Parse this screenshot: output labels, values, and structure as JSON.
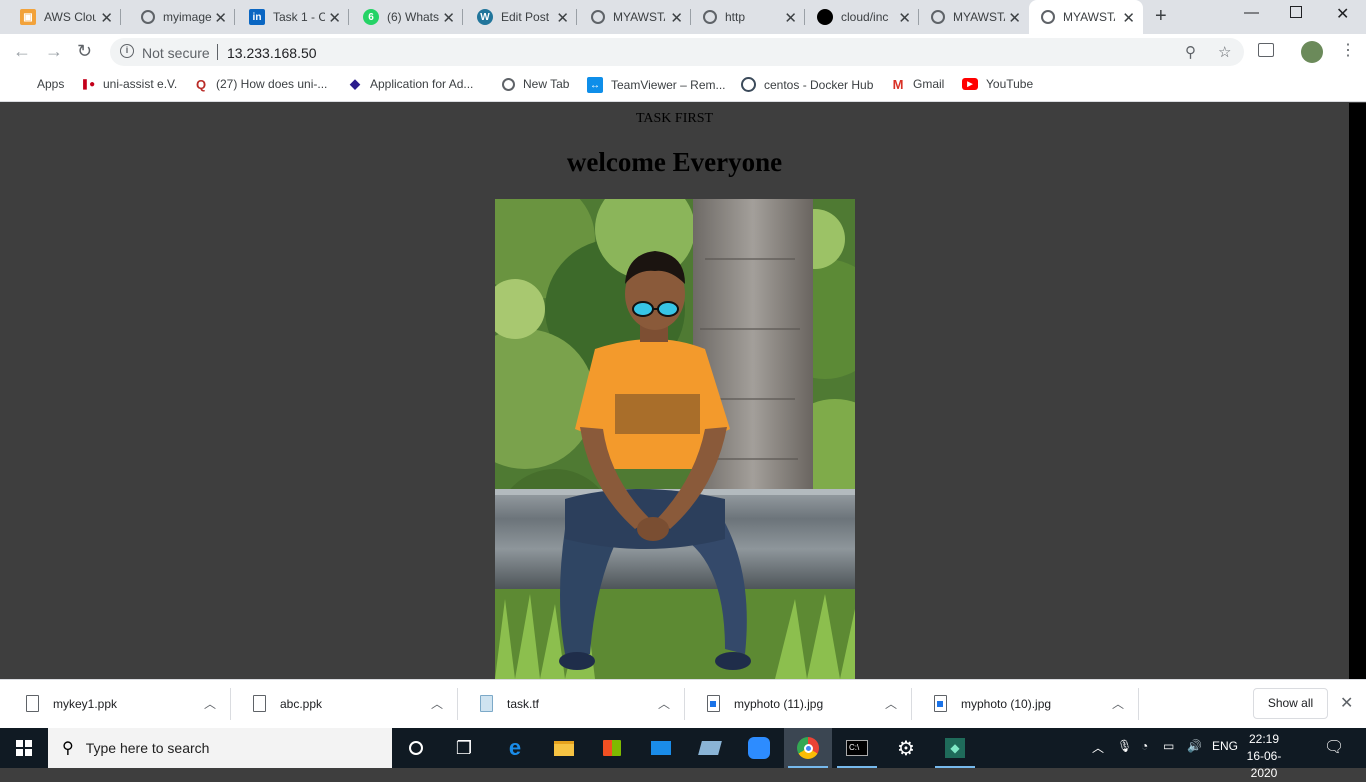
{
  "tabs": [
    {
      "title": "AWS Clou",
      "icon": "aws-box-icon",
      "color": "#f2a23a"
    },
    {
      "title": "myimage",
      "icon": "globe-icon",
      "color": "#5f6368"
    },
    {
      "title": "Task 1 - C",
      "icon": "linkedin-icon",
      "color": "#0a66c2"
    },
    {
      "title": "(6) Whats",
      "icon": "whatsapp-icon",
      "color": "#25d366"
    },
    {
      "title": "Edit Post",
      "icon": "wordpress-icon",
      "color": "#21759b"
    },
    {
      "title": "MYAWSTA",
      "icon": "globe-icon",
      "color": "#5f6368"
    },
    {
      "title": "http",
      "icon": "globe-icon",
      "color": "#5f6368"
    },
    {
      "title": "cloud/inc",
      "icon": "github-icon",
      "color": "#000000"
    },
    {
      "title": "MYAWSTA",
      "icon": "globe-icon",
      "color": "#5f6368"
    },
    {
      "title": "MYAWSTA",
      "icon": "globe-icon",
      "color": "#5f6368"
    }
  ],
  "address_bar": {
    "security_label": "Not secure",
    "url": "13.233.168.50"
  },
  "bookmarks": [
    {
      "label": "Apps",
      "icon": "apps-grid-icon"
    },
    {
      "label": "uni-assist e.V.",
      "icon": "uni-assist-icon"
    },
    {
      "label": "(27) How does uni-...",
      "icon": "quora-icon"
    },
    {
      "label": "Application for Ad...",
      "icon": "diamond-icon"
    },
    {
      "label": "New Tab",
      "icon": "globe-icon"
    },
    {
      "label": "TeamViewer – Rem...",
      "icon": "teamviewer-icon"
    },
    {
      "label": "centos - Docker Hub",
      "icon": "docker-icon"
    },
    {
      "label": "Gmail",
      "icon": "gmail-icon"
    },
    {
      "label": "YouTube",
      "icon": "youtube-icon"
    }
  ],
  "page": {
    "subtitle": "TASK FIRST",
    "heading": "welcome Everyone",
    "background": "#3e3e3e"
  },
  "downloads": [
    {
      "name": "mykey1.ppk",
      "type": "file"
    },
    {
      "name": "abc.ppk",
      "type": "file"
    },
    {
      "name": "task.tf",
      "type": "tf"
    },
    {
      "name": "myphoto (11).jpg",
      "type": "img"
    },
    {
      "name": "myphoto (10).jpg",
      "type": "img"
    }
  ],
  "show_all_label": "Show all",
  "taskbar": {
    "search_placeholder": "Type here to search",
    "language": "ENG",
    "time": "22:19",
    "date": "16-06-2020"
  }
}
